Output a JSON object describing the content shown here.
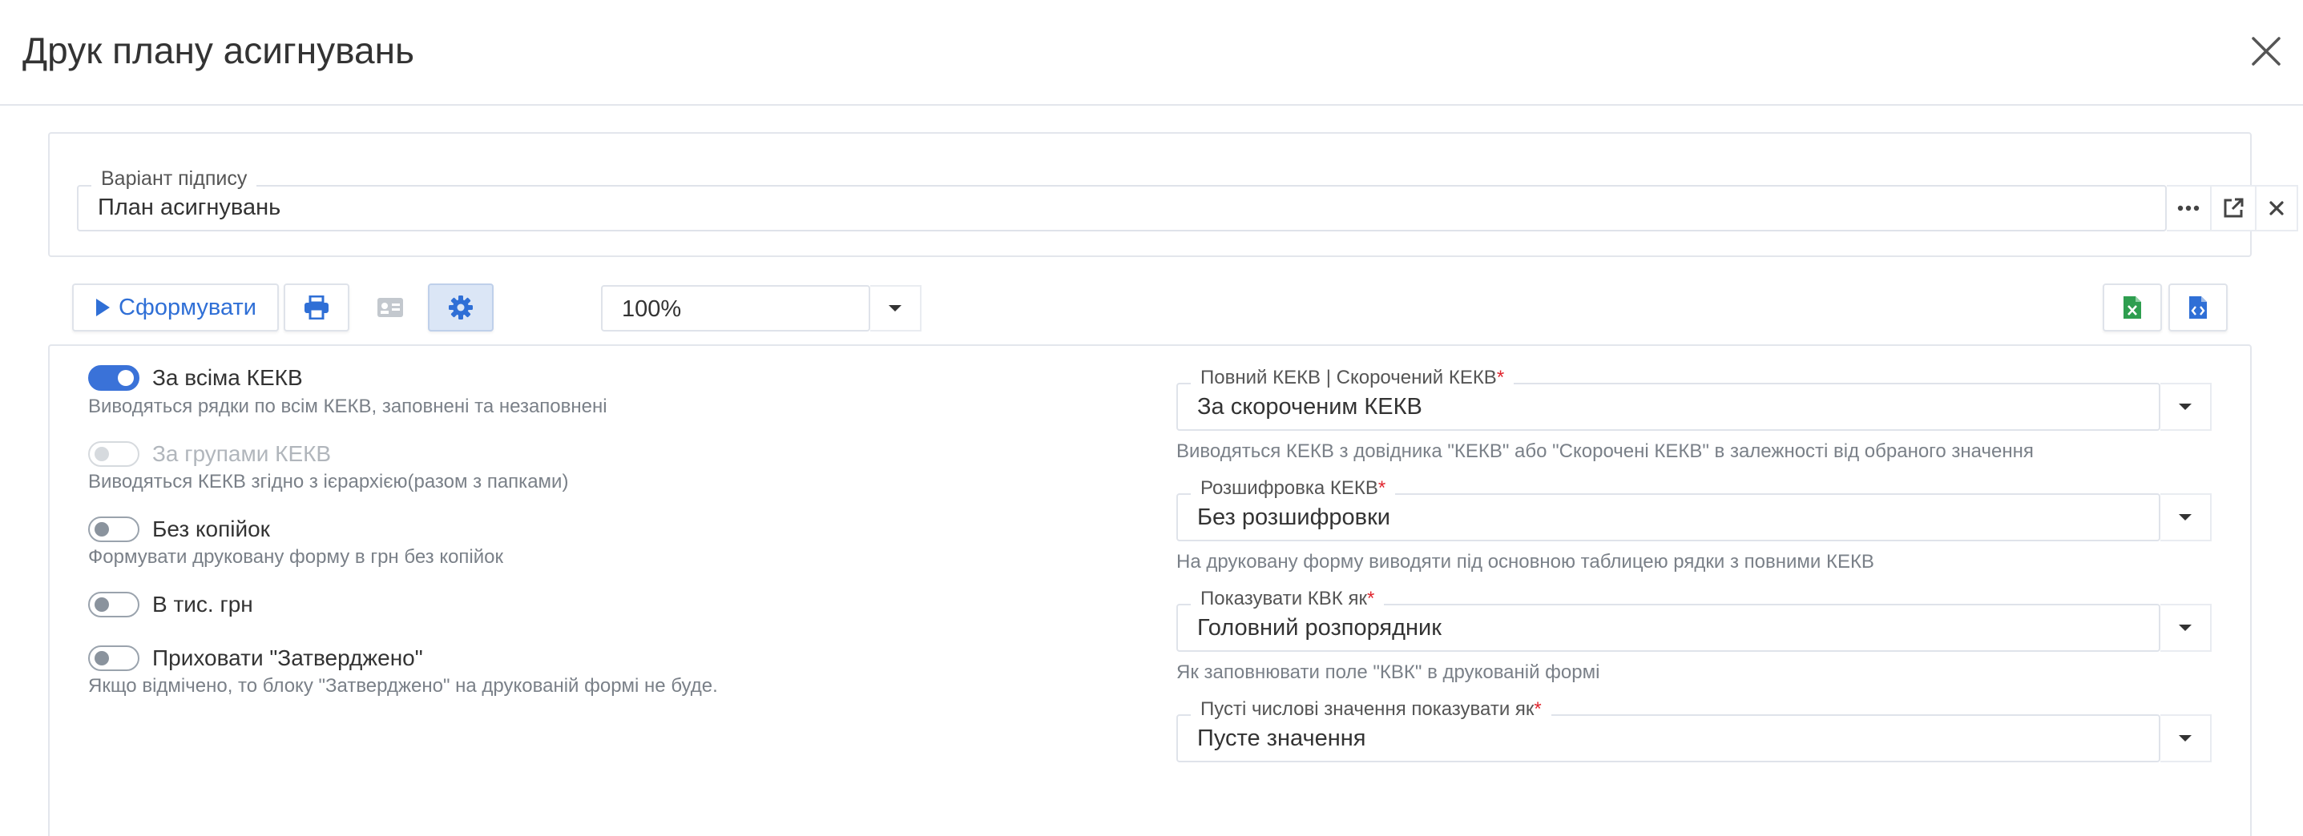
{
  "header": {
    "title": "Друк плану асигнувань"
  },
  "signature": {
    "legend": "Варіант підпису",
    "value": "План асигнувань"
  },
  "toolbar": {
    "form_label": "Сформувати",
    "zoom": "100%"
  },
  "toggles": [
    {
      "label": "За всіма КЕКВ",
      "desc": "Виводяться рядки по всім КЕКВ, заповнені та незаповнені",
      "state": "on"
    },
    {
      "label": "За групами КЕКВ",
      "desc": "Виводяться КЕКВ згідно з ієрархією(разом з папками)",
      "state": "disabled"
    },
    {
      "label": "Без копійок",
      "desc": "Формувати друковану форму в грн без копійок",
      "state": "off"
    },
    {
      "label": "В тис. грн",
      "desc": "",
      "state": "off"
    },
    {
      "label": "Приховати \"Затверджено\"",
      "desc": "Якщо відмічено, то блоку \"Затверджено\" на друкованій формі не буде.",
      "state": "off"
    }
  ],
  "selects": [
    {
      "legend": "Повний КЕКВ | Скорочений КЕКВ",
      "value": "За скороченим КЕКВ",
      "desc": "Виводяться КЕКВ з довідника \"КЕКВ\" або \"Скорочені КЕКВ\" в залежності від обраного значення"
    },
    {
      "legend": "Розшифровка КЕКВ",
      "value": "Без розшифровки",
      "desc": "На друковану форму виводяти під основною таблицею рядки з повними КЕКВ"
    },
    {
      "legend": "Показувати КВК як",
      "value": "Головний розпорядник",
      "desc": "Як заповнювати поле \"КВК\" в друкованій формі"
    },
    {
      "legend": "Пусті числові значення показувати як",
      "value": "Пусте значення",
      "desc": ""
    }
  ],
  "required_mark": "*",
  "colors": {
    "accent": "#3a72d8",
    "excel": "#2e9e4f",
    "xml": "#2f6fd6",
    "required": "#e0262f"
  }
}
